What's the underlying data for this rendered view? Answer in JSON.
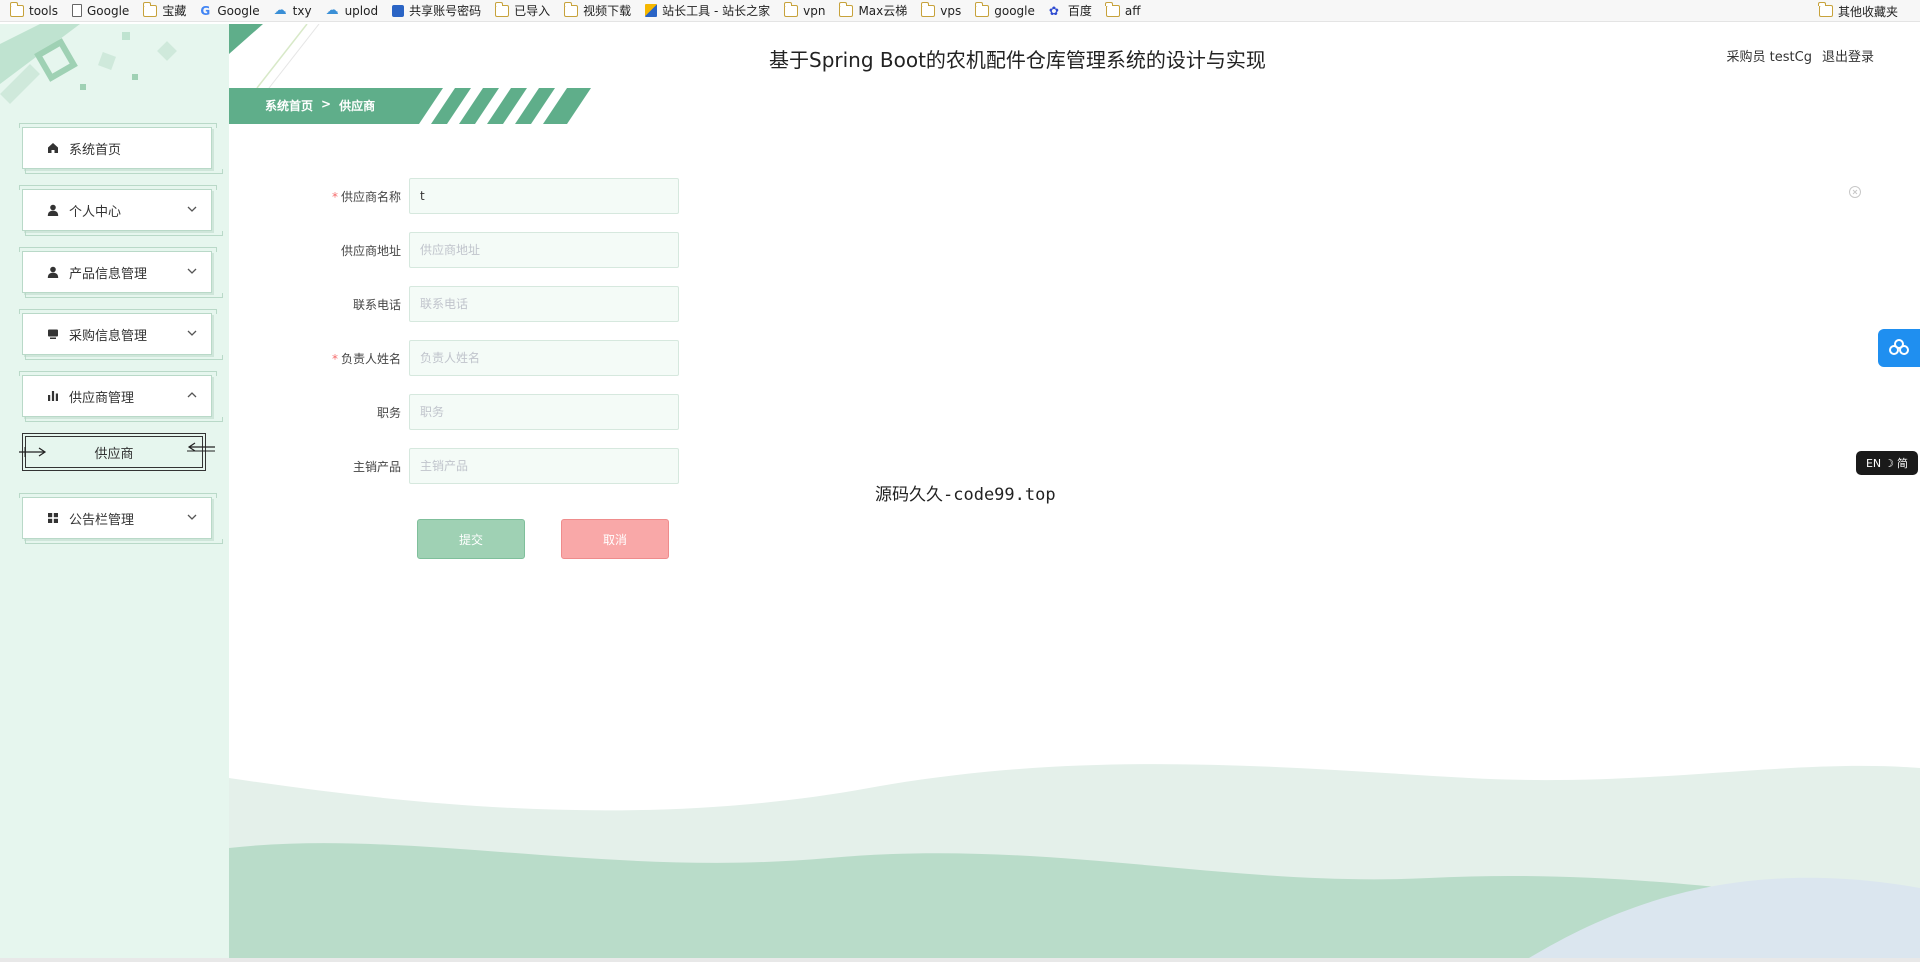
{
  "bookmarks": [
    {
      "label": "tools",
      "icon": "folder-icon"
    },
    {
      "label": "Google",
      "icon": "page-icon"
    },
    {
      "label": "宝藏",
      "icon": "folder-icon"
    },
    {
      "label": "Google",
      "icon": "google-icon"
    },
    {
      "label": "txy",
      "icon": "cloud-icon"
    },
    {
      "label": "uplod",
      "icon": "cloud-icon"
    },
    {
      "label": "共享账号密码",
      "icon": "share-icon"
    },
    {
      "label": "已导入",
      "icon": "folder-icon"
    },
    {
      "label": "视频下载",
      "icon": "folder-icon"
    },
    {
      "label": "站长工具 - 站长之家",
      "icon": "tool-icon"
    },
    {
      "label": "vpn",
      "icon": "folder-icon"
    },
    {
      "label": "Max云梯",
      "icon": "folder-icon"
    },
    {
      "label": "vps",
      "icon": "folder-icon"
    },
    {
      "label": "google",
      "icon": "folder-icon"
    },
    {
      "label": "百度",
      "icon": "baidu-icon"
    },
    {
      "label": "aff",
      "icon": "folder-icon"
    }
  ],
  "bookmarks_other": "其他收藏夹",
  "header": {
    "title": "基于Spring Boot的农机配件仓库管理系统的设计与实现",
    "user_label": "采购员 testCg",
    "logout_label": "退出登录"
  },
  "breadcrumb": {
    "home": "系统首页",
    "separator": ">",
    "current": "供应商"
  },
  "sidebar": {
    "items": [
      {
        "label": "系统首页",
        "icon": "home-icon",
        "expandable": false
      },
      {
        "label": "个人中心",
        "icon": "user-icon",
        "expandable": true
      },
      {
        "label": "产品信息管理",
        "icon": "user-icon",
        "expandable": true
      },
      {
        "label": "采购信息管理",
        "icon": "monitor-icon",
        "expandable": true
      },
      {
        "label": "供应商管理",
        "icon": "bar-chart-icon",
        "expandable": true,
        "expanded": true
      },
      {
        "label": "公告栏管理",
        "icon": "grid-icon",
        "expandable": true
      }
    ],
    "submenu": {
      "label": "供应商"
    }
  },
  "form": {
    "fields": [
      {
        "label": "供应商名称",
        "required": true,
        "value": "t",
        "placeholder": ""
      },
      {
        "label": "供应商地址",
        "required": false,
        "value": "",
        "placeholder": "供应商地址"
      },
      {
        "label": "联系电话",
        "required": false,
        "value": "",
        "placeholder": "联系电话"
      },
      {
        "label": "负责人姓名",
        "required": true,
        "value": "",
        "placeholder": "负责人姓名"
      },
      {
        "label": "职务",
        "required": false,
        "value": "",
        "placeholder": "职务"
      },
      {
        "label": "主销产品",
        "required": false,
        "value": "",
        "placeholder": "主销产品"
      }
    ],
    "submit_label": "提交",
    "cancel_label": "取消"
  },
  "watermark": "源码久久-code99.top",
  "lang_switch": {
    "en": "EN",
    "zh": "简"
  },
  "colors": {
    "sidebar_bg": "#e6f6ee",
    "accent_green": "#5fae8a",
    "submit_btn": "#9fd1b4",
    "cancel_btn": "#f9a8a8",
    "required_mark": "#f56c6c",
    "float_blue": "#1f8ff0"
  }
}
